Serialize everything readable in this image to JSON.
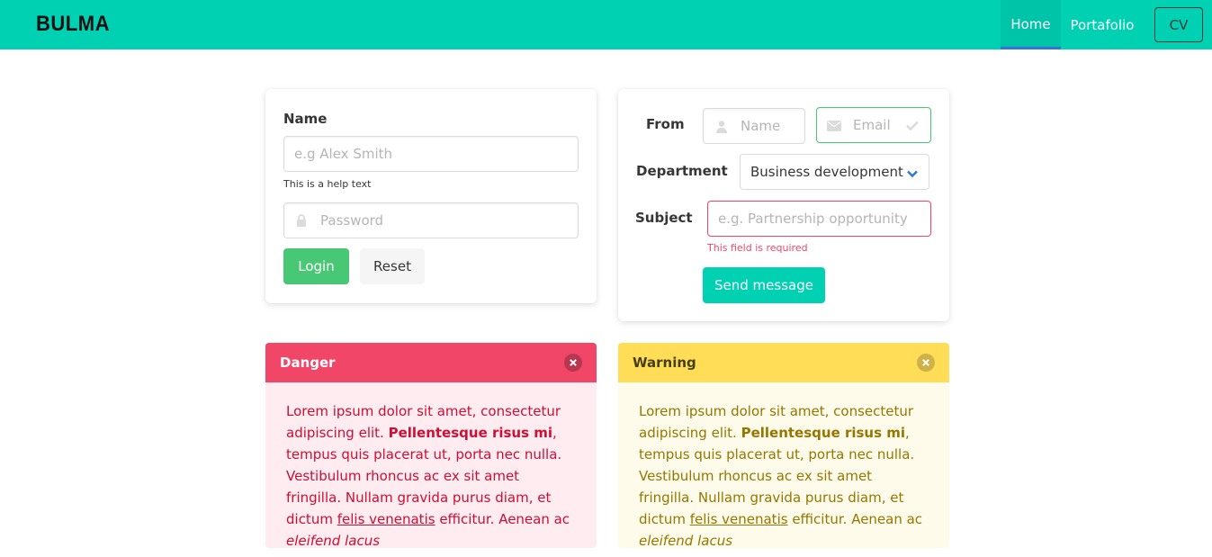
{
  "navbar": {
    "brand": "BULMA",
    "items": [
      {
        "label": "Home"
      },
      {
        "label": "Portafolio"
      }
    ],
    "cv_label": "CV",
    "color": "#00d1b2"
  },
  "login_form": {
    "name_label": "Name",
    "name_placeholder": "e.g Alex Smith",
    "help_text": "This is a help text",
    "password_placeholder": "Password",
    "login_label": "Login",
    "reset_label": "Reset"
  },
  "contact_form": {
    "from_label": "From",
    "name_placeholder": "Name",
    "email_placeholder": "Email",
    "department_label": "Department",
    "department_value": "Business development",
    "subject_label": "Subject",
    "subject_placeholder": "e.g. Partnership opportunity",
    "error_text": "This field is required",
    "send_label": "Send message"
  },
  "messages": {
    "danger": {
      "title": "Danger",
      "text_1": "Lorem ipsum dolor sit amet, consectetur adipiscing elit. ",
      "bold": "Pellentesque risus mi",
      "text_2": ", tempus quis placerat ut, porta nec nulla. Vestibulum rhoncus ac ex sit amet fringilla. Nullam gravida purus diam, et dictum ",
      "link": "felis venenatis",
      "text_3": " efficitur. Aenean ac ",
      "italic": "eleifend lacus"
    },
    "warning": {
      "title": "Warning",
      "text_1": "Lorem ipsum dolor sit amet, consectetur adipiscing elit. ",
      "bold": "Pellentesque risus mi",
      "text_2": ", tempus quis placerat ut, porta nec nulla. Vestibulum rhoncus ac ex sit amet fringilla. Nullam gravida purus diam, et dictum ",
      "link": "felis venenatis",
      "text_3": " efficitur. Aenean ac ",
      "italic": "eleifend lacus"
    }
  }
}
